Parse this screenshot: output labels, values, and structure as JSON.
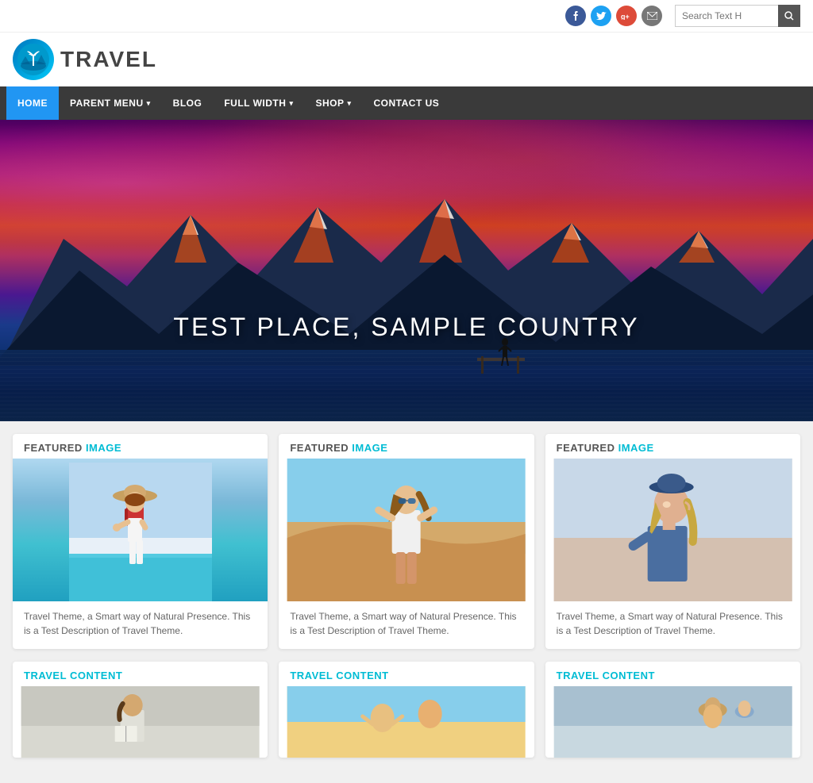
{
  "topbar": {
    "search_placeholder": "Search Text H",
    "social": {
      "facebook": "f",
      "twitter": "t",
      "google": "g+",
      "email": "@"
    }
  },
  "header": {
    "logo_text": "TRAVEL",
    "logo_alt": "Travel Logo"
  },
  "nav": {
    "items": [
      {
        "id": "home",
        "label": "HOME",
        "active": true,
        "has_dropdown": false
      },
      {
        "id": "parent-menu",
        "label": "PARENT MENU",
        "active": false,
        "has_dropdown": true
      },
      {
        "id": "blog",
        "label": "BLOG",
        "active": false,
        "has_dropdown": false
      },
      {
        "id": "full-width",
        "label": "FULL WIDTH",
        "active": false,
        "has_dropdown": true
      },
      {
        "id": "shop",
        "label": "SHOP",
        "active": false,
        "has_dropdown": true
      },
      {
        "id": "contact",
        "label": "CONTACT US",
        "active": false,
        "has_dropdown": false
      }
    ]
  },
  "hero": {
    "title": "TEST PLACE, SAMPLE COUNTRY"
  },
  "featured_cards": [
    {
      "id": "card-1",
      "heading_static": "FEATURED",
      "heading_accent": "IMAGE",
      "description": "Travel Theme, a Smart way of Natural Presence. This is a Test Description of Travel Theme."
    },
    {
      "id": "card-2",
      "heading_static": "FEATURED",
      "heading_accent": "IMAGE",
      "description": "Travel Theme, a Smart way of Natural Presence. This is a Test Description of Travel Theme."
    },
    {
      "id": "card-3",
      "heading_static": "FEATURED",
      "heading_accent": "IMAGE",
      "description": "Travel Theme, a Smart way of Natural Presence. This is a Test Description of Travel Theme."
    }
  ],
  "travel_cards": [
    {
      "id": "travel-1",
      "heading_static": "TRAVEL",
      "heading_accent": "CONTENT"
    },
    {
      "id": "travel-2",
      "heading_static": "TRAVEL",
      "heading_accent": "CONTENT"
    },
    {
      "id": "travel-3",
      "heading_static": "TRAVEL",
      "heading_accent": "CONTENT"
    }
  ],
  "colors": {
    "accent": "#00bcd4",
    "nav_bg": "#3a3a3a",
    "nav_active": "#2196f3"
  }
}
